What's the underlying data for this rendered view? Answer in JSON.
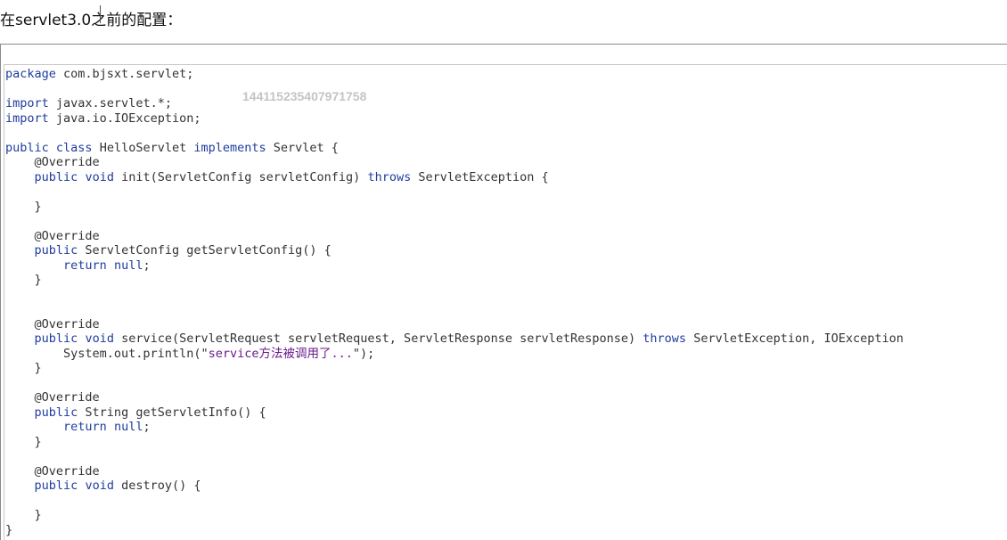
{
  "heading": "在servlet3.0之前的配置：",
  "watermark": "144115235407971758",
  "code": {
    "line_01": "package com.bjsxt.servlet;",
    "line_02": "",
    "line_03": "import javax.servlet.*;",
    "line_04": "import java.io.IOException;",
    "line_05": "",
    "line_06": "public class HelloServlet implements Servlet {",
    "line_07": "    @Override",
    "line_08": "    public void init(ServletConfig servletConfig) throws ServletException {",
    "line_09": "",
    "line_10": "    }",
    "line_11": "",
    "line_12": "    @Override",
    "line_13": "    public ServletConfig getServletConfig() {",
    "line_14": "        return null;",
    "line_15": "    }",
    "line_16": "",
    "line_17": "",
    "line_18": "    @Override",
    "line_19": "    public void service(ServletRequest servletRequest, ServletResponse servletResponse) throws ServletException, IOException",
    "line_20": "        System.out.println(\"service方法被调用了...\");",
    "line_21": "    }",
    "line_22": "",
    "line_23": "    @Override",
    "line_24": "    public String getServletInfo() {",
    "line_25": "        return null;",
    "line_26": "    }",
    "line_27": "",
    "line_28": "    @Override",
    "line_29": "    public void destroy() {",
    "line_30": "",
    "line_31": "    }",
    "line_32": "}"
  },
  "colors": {
    "keyword": "#1f3c9e",
    "string": "#6a1a8a",
    "text": "#333333",
    "watermark": "#c4c4c4"
  }
}
